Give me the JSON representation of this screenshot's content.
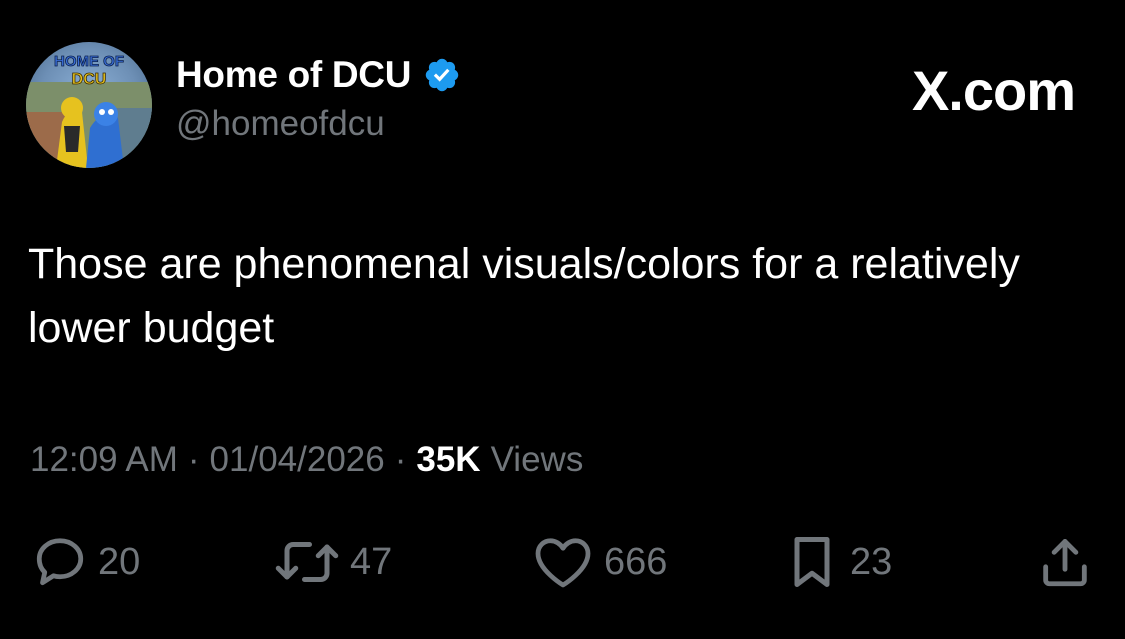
{
  "brand": {
    "text": "X.com"
  },
  "author": {
    "display_name": "Home of DCU",
    "handle": "@homeofdcu",
    "verified": true,
    "avatar_text_line1": "HOME OF",
    "avatar_text_line2": "DCU"
  },
  "tweet": {
    "text": "Those are phenomenal visuals/colors for a relatively lower budget"
  },
  "meta": {
    "time": "12:09 AM",
    "separator": "·",
    "date": "01/04/2026",
    "views_count": "35K",
    "views_label": "Views"
  },
  "actions": {
    "replies": "20",
    "reposts": "47",
    "likes": "666",
    "bookmarks": "23"
  },
  "colors": {
    "background": "#000000",
    "text_primary": "#ffffff",
    "text_secondary": "#71767b",
    "verified_blue": "#1d9bf0"
  },
  "icons": {
    "reply": "speech-bubble-icon",
    "repost": "repost-arrows-icon",
    "like": "heart-icon",
    "bookmark": "bookmark-icon",
    "share": "share-upload-icon",
    "verified": "verified-badge-icon"
  }
}
